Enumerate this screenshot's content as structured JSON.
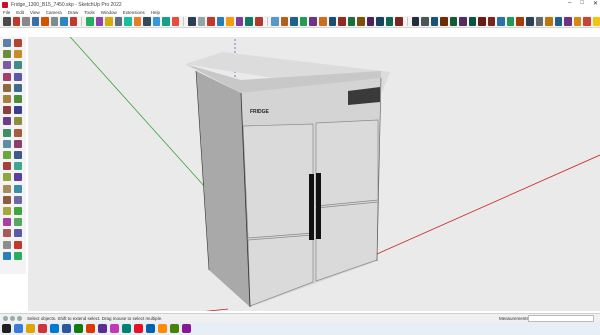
{
  "window": {
    "title": "Fridge_1300_B15_7450.skp - SketchUp Pro 2022",
    "controls": [
      "–",
      "□",
      "✕"
    ]
  },
  "menu": [
    "File",
    "Edit",
    "View",
    "Camera",
    "Draw",
    "Tools",
    "Window",
    "Extensions",
    "Help"
  ],
  "toolbar": {
    "icon_colors": [
      "#4a4a4a",
      "#c0392b",
      "#888888",
      "#3a6ea5",
      "#d35400",
      "#7f8c8d",
      "#2e86c1",
      "#c0392b",
      "#27ae60",
      "#8e44ad",
      "#d4ac0d",
      "#5d6d7e",
      "#1abc9c",
      "#e67e22",
      "#34495e",
      "#3498db",
      "#16a085",
      "#e74c3c",
      "#2c3e50",
      "#95a5a6",
      "#c0392b",
      "#2980b9",
      "#f39c12",
      "#7d3c98",
      "#117a65",
      "#b03a2e",
      "#5499c7",
      "#af601a",
      "#1f618d",
      "#239b56",
      "#6c3483",
      "#ca6f1e",
      "#1b4f72",
      "#922b21",
      "#196f3d",
      "#7e5109",
      "#4a235a",
      "#154360",
      "#0e6655",
      "#78281f",
      "#212f3d",
      "#4d5656",
      "#1a5276",
      "#6e2c00",
      "#145a32",
      "#512e5f",
      "#0b5345",
      "#641e16",
      "#7b241c",
      "#2874a6",
      "#229954",
      "#a04000",
      "#2e4053",
      "#616a6b",
      "#b9770e",
      "#1f618d",
      "#6c3483",
      "#d68910",
      "#cb4335",
      "#f1c40f"
    ]
  },
  "left_toolbar": {
    "icon_colors": [
      "#5b7fa6",
      "#b04632",
      "#6a8d3e",
      "#c98b2a",
      "#7b5aa6",
      "#3e8d8a",
      "#a63e6a",
      "#5a5aa6",
      "#8d6a3e",
      "#3e6a8d",
      "#a6823e",
      "#4e8d3e",
      "#8d3e3e",
      "#3e3e8d",
      "#6a3e8d",
      "#8d8d3e",
      "#3e8d6a",
      "#a65a3e",
      "#5a8da6",
      "#8d3e6a",
      "#6aa63e",
      "#3e5a8d",
      "#a63e3e",
      "#3ea68d",
      "#8da63e",
      "#5a3ea6",
      "#a68d5a",
      "#3e8da6",
      "#8d5a3e",
      "#6a6aa6",
      "#a6a63e",
      "#3ea63e",
      "#a63ea6",
      "#5aa65a",
      "#a65a5a",
      "#5a5aa6",
      "#8d8d8d",
      "#c0392b",
      "#2980b9",
      "#27ae60"
    ]
  },
  "model": {
    "brand_label": "FRIDGE",
    "colors": {
      "sky": "#eaeaea",
      "top": "#dcdcdc",
      "side": "#a9a9a9",
      "front": "#d4d4d4",
      "door": "#dadada",
      "handle": "#111111",
      "display": "#3a3a3a",
      "axis_red": "#cc2222",
      "axis_green": "#3aa63a",
      "axis_blue": "#2233aa"
    }
  },
  "status": {
    "text": "Select objects. Shift to extend select. Drag mouse to select multiple.",
    "measurements_label": "Measurements",
    "measurements_value": ""
  },
  "taskbar": {
    "icon_colors": [
      "#1f1f1f",
      "#3a7bd5",
      "#e0a500",
      "#d13438",
      "#0078d4",
      "#2b579a",
      "#107c10",
      "#d83b01",
      "#5c2d91",
      "#c239b3",
      "#008272",
      "#e81123",
      "#0063b1",
      "#ff8c00",
      "#498205",
      "#881798"
    ]
  }
}
